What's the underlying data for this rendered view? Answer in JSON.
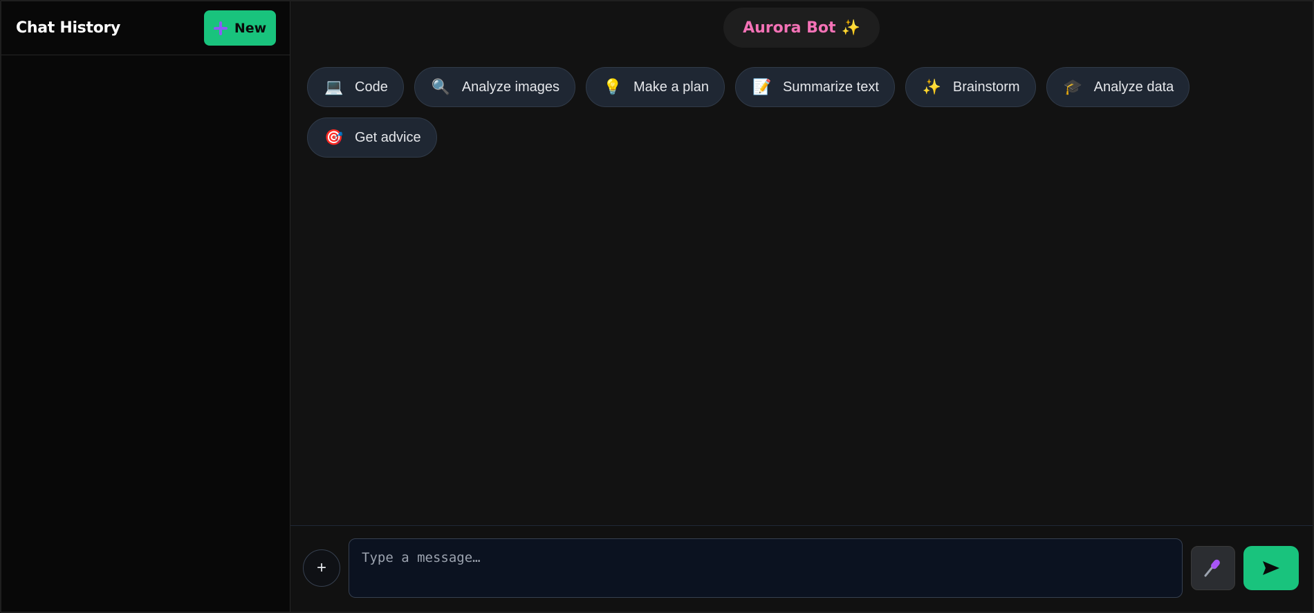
{
  "sidebar": {
    "title": "Chat History",
    "new_button_label": "New",
    "new_button_icon": "plus-icon"
  },
  "header": {
    "bot_name": "Aurora Bot",
    "bot_icon": "sparkles-icon",
    "bot_icon_glyph": "✨"
  },
  "suggestions": [
    {
      "label": "Code",
      "icon": "laptop-icon",
      "glyph": "💻"
    },
    {
      "label": "Analyze images",
      "icon": "magnifier-icon",
      "glyph": "🔍"
    },
    {
      "label": "Make a plan",
      "icon": "lightbulb-icon",
      "glyph": "💡"
    },
    {
      "label": "Summarize text",
      "icon": "memo-icon",
      "glyph": "📝"
    },
    {
      "label": "Brainstorm",
      "icon": "sparkles-icon",
      "glyph": "✨"
    },
    {
      "label": "Analyze data",
      "icon": "graduation-cap-icon",
      "glyph": "🎓"
    },
    {
      "label": "Get advice",
      "icon": "target-icon",
      "glyph": "🎯"
    }
  ],
  "composer": {
    "placeholder": "Type a message…",
    "attach_label": "+",
    "mic_icon": "microphone-icon",
    "send_icon": "send-icon"
  },
  "colors": {
    "accent": "#19c37d",
    "brand": "#f472b6",
    "background": "#121212",
    "sidebar": "#080808"
  }
}
